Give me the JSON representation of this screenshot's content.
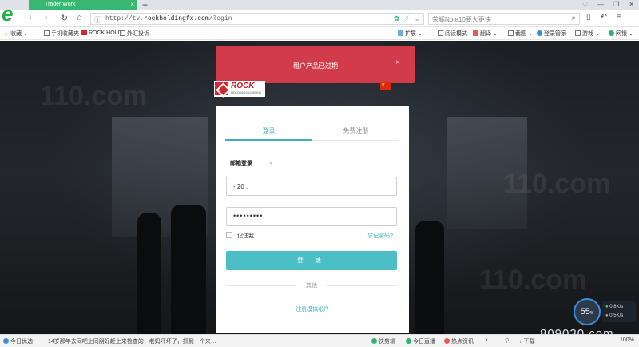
{
  "browser": {
    "tab_title": "Trader Work",
    "url_prefix": "http://tv.",
    "url_domain": "rockholdingfx.com",
    "url_path": "/login",
    "search_placeholder": "荣耀Note10要大更快"
  },
  "bookmarks": [
    {
      "label": "收藏"
    },
    {
      "label": "手机收藏夹"
    },
    {
      "label": "ROCK HOLD"
    },
    {
      "label": "外汇投诉"
    }
  ],
  "toolbar_right": [
    {
      "label": "扩展"
    },
    {
      "label": "阅读模式"
    },
    {
      "label": "翻译"
    },
    {
      "label": "截图"
    },
    {
      "label": "登录管家"
    },
    {
      "label": "游戏"
    },
    {
      "label": "网银"
    }
  ],
  "alert": {
    "message": "租户产品已过期"
  },
  "brand": {
    "name": "ROCK",
    "sub": "HOLDINGS LIMITED"
  },
  "login": {
    "tab_login": "登录",
    "tab_register": "免费注册",
    "method": "邮箱登录",
    "email_value": "- 20 .",
    "password_value": "•••••••••",
    "remember": "记住我",
    "forgot": "忘记密码?",
    "submit": "登 录",
    "other": "其他",
    "demo": "注册模拟帐户"
  },
  "speed": {
    "percent": "55",
    "percent_unit": "%",
    "up": "0.8K/s",
    "down": "0.5K/s"
  },
  "watermark": "809030.com",
  "bg_watermark": "110.com",
  "statusbar": {
    "left_label": "今日优选",
    "news": "14岁那年去同吧上同朋好赶上来检查的，老妈吓坏了，抓到一个来…",
    "items": [
      {
        "label": "快剪辑"
      },
      {
        "label": "今日直播"
      },
      {
        "label": "热点资讯"
      }
    ],
    "download": "下载",
    "zoom": "100%"
  }
}
